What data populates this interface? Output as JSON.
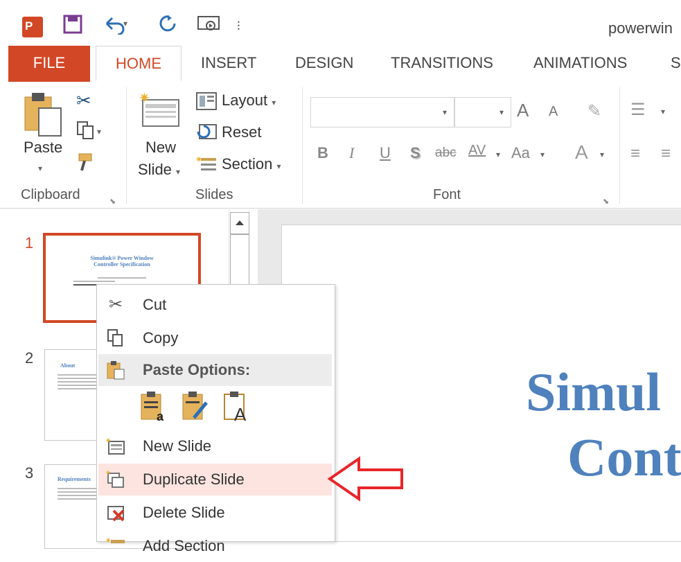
{
  "window": {
    "title": "powerwin"
  },
  "tabs": [
    "FILE",
    "HOME",
    "INSERT",
    "DESIGN",
    "TRANSITIONS",
    "ANIMATIONS",
    "S"
  ],
  "ribbon": {
    "clipboard": {
      "paste_label": "Paste",
      "group_label": "Clipboard"
    },
    "slides": {
      "new_slide_line1": "New",
      "new_slide_line2": "Slide",
      "layout": "Layout",
      "reset": "Reset",
      "section": "Section",
      "group_label": "Slides"
    },
    "font": {
      "group_label": "Font",
      "bold": "B",
      "italic": "I",
      "underline": "U",
      "shadow": "S",
      "strike": "abc",
      "spacing": "AV",
      "case": "Aa",
      "color": "A",
      "grow": "A",
      "shrink": "A"
    }
  },
  "slides": [
    {
      "number": "1",
      "title_line1": "Simulink® Power Window",
      "title_line2": "Controller Specification"
    },
    {
      "number": "2",
      "title": "About"
    },
    {
      "number": "3",
      "title": "Requirements"
    }
  ],
  "canvas": {
    "line1": "Simul",
    "line2": "Cont"
  },
  "context_menu": {
    "cut": "Cut",
    "copy": "Copy",
    "paste_options": "Paste Options:",
    "new_slide": "New Slide",
    "duplicate_slide": "Duplicate Slide",
    "delete_slide": "Delete Slide",
    "add_section": "Add Section"
  },
  "colors": {
    "accent": "#d24726",
    "title_blue": "#4f81bd",
    "highlight": "#fde4e0",
    "arrow": "#e8262a"
  }
}
